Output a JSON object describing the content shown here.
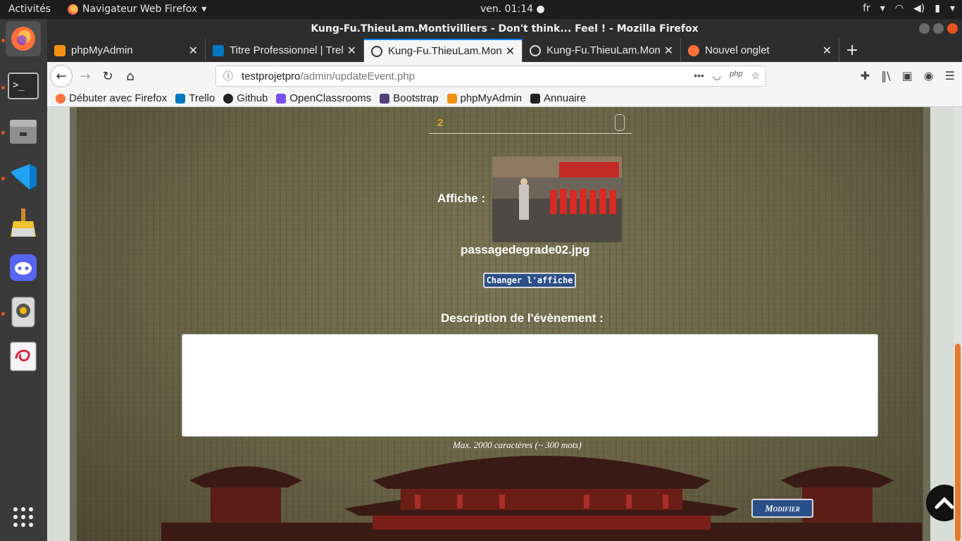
{
  "topbar": {
    "activities": "Activités",
    "app_name": "Navigateur Web Firefox",
    "clock": "ven. 01:14",
    "lang": "fr"
  },
  "window": {
    "title": "Kung-Fu.ThieuLam.Montivilliers - Don't think... Feel ! - Mozilla Firefox"
  },
  "tabs": [
    {
      "title": "phpMyAdmin",
      "icon": "phpmyadmin-icon",
      "selected": false
    },
    {
      "title": "Titre Professionnel | Trello",
      "icon": "trello-icon",
      "selected": false
    },
    {
      "title": "Kung-Fu.ThieuLam.Montivilliers",
      "icon": "site-icon",
      "selected": true
    },
    {
      "title": "Kung-Fu.ThieuLam.Montivilliers",
      "icon": "site-icon",
      "selected": false
    },
    {
      "title": "Nouvel onglet",
      "icon": "firefox-icon",
      "selected": false
    }
  ],
  "url": {
    "host": "testprojetpro",
    "path": "/admin/updateEvent.php"
  },
  "bookmarks": [
    {
      "label": "Débuter avec Firefox",
      "icon": "firefox-icon",
      "color": "#ff7139"
    },
    {
      "label": "Trello",
      "icon": "trello-icon",
      "color": "#0079bf"
    },
    {
      "label": "Github",
      "icon": "github-icon",
      "color": "#222222"
    },
    {
      "label": "OpenClassrooms",
      "icon": "openclassrooms-icon",
      "color": "#7451eb"
    },
    {
      "label": "Bootstrap",
      "icon": "bootstrap-icon",
      "color": "#563d7c"
    },
    {
      "label": "phpMyAdmin",
      "icon": "phpmyadmin-icon",
      "color": "#f29111"
    },
    {
      "label": "Annuaire",
      "icon": "annuaire-icon",
      "color": "#222222"
    }
  ],
  "form": {
    "number_value": "2",
    "affiche_label": "Affiche :",
    "poster_filename": "passagedegrade02.jpg",
    "change_button": "Changer l'affiche",
    "description_label": "Description de l'évènement :",
    "description_value": "",
    "hint": "Max. 2000 caractères (~ 300 mots)",
    "submit_button": "Modifier"
  },
  "colors": {
    "accent_orange": "#e95420",
    "button_blue": "#2b4f88",
    "number_gold": "#e0a82a"
  }
}
